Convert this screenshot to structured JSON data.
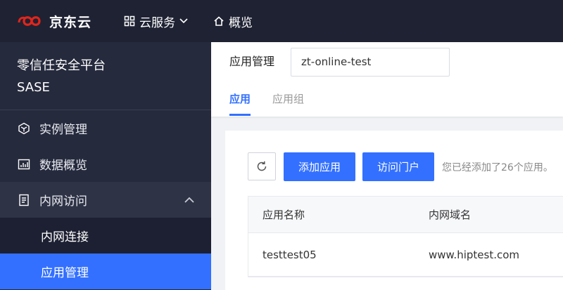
{
  "topbar": {
    "brand": "京东云",
    "services_label": "云服务",
    "overview_label": "概览"
  },
  "sidebar": {
    "title": "零信任安全平台",
    "subtitle": "SASE",
    "items": [
      {
        "label": "实例管理",
        "icon": "cube-icon"
      },
      {
        "label": "数据概览",
        "icon": "chart-icon"
      },
      {
        "label": "内网访问",
        "icon": "document-icon",
        "expanded": true
      }
    ],
    "subitems": [
      {
        "label": "内网连接",
        "active": false
      },
      {
        "label": "应用管理",
        "active": true
      }
    ]
  },
  "main": {
    "app_select_label": "应用管理",
    "app_select_value": "zt-online-test",
    "tabs": [
      {
        "label": "应用",
        "active": true
      },
      {
        "label": "应用组",
        "active": false
      }
    ],
    "buttons": {
      "add": "添加应用",
      "portal": "访问门户"
    },
    "hint": "您已经添加了26个应用。",
    "table": {
      "columns": [
        "应用名称",
        "内网域名"
      ],
      "rows": [
        [
          "testtest05",
          "www.hiptest.com"
        ]
      ]
    }
  },
  "colors": {
    "topbar_bg": "#1f2233",
    "sidebar_bg": "#262a3d",
    "accent": "#3370ff",
    "logo_red": "#e1251b"
  }
}
